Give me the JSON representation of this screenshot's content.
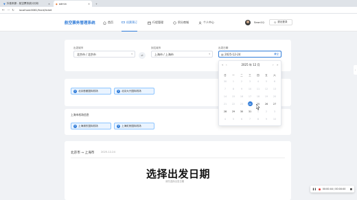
{
  "browser": {
    "tabs": [
      {
        "label": "抖音来源 - 航空票务统计分析"
      },
      {
        "label": "admin"
      }
    ],
    "new_tab": "+",
    "url": "localhost:8081/front/ticket"
  },
  "header": {
    "logo": "航空票务管理系统",
    "nav": [
      {
        "label": "首页"
      },
      {
        "label": "机票预订"
      },
      {
        "label": "行程管理"
      },
      {
        "label": "积分商城"
      },
      {
        "label": "个人中心"
      }
    ],
    "username": "Sean1Q",
    "logout_label": "退出登录"
  },
  "search": {
    "from_label": "出发城市",
    "from_value": "北京市 / 北京市",
    "to_label": "到达城市",
    "to_value": "上海市 / 上海市",
    "date_label": "出发日期",
    "date_value": "2025-12-24",
    "swap_label": "⇄",
    "clear_label": "清空"
  },
  "beijing_airports": {
    "title": "北京市机场信息",
    "items": [
      "北京首都国际机场",
      "北京大兴国际机场"
    ]
  },
  "shanghai_airports": {
    "title": "上海市机场信息",
    "items": [
      "上海浦东国际机场",
      "上海虹桥国际机场"
    ]
  },
  "picker": {
    "title": "2025 年  12 月",
    "weekdays": [
      "日",
      "一",
      "二",
      "三",
      "四",
      "五",
      "六"
    ],
    "rows": [
      [
        "30",
        "1",
        "2",
        "3",
        "4",
        "5",
        "6"
      ],
      [
        "7",
        "8",
        "9",
        "10",
        "11",
        "12",
        "13"
      ],
      [
        "14",
        "15",
        "16",
        "17",
        "18",
        "19",
        "20"
      ],
      [
        "21",
        "22",
        "23",
        "24",
        "25",
        "26",
        "27"
      ],
      [
        "28",
        "29",
        "30",
        "31",
        "1",
        "2",
        "3"
      ],
      [
        "4",
        "5",
        "6",
        "7",
        "8",
        "9",
        "10"
      ]
    ],
    "selected": "24"
  },
  "result": {
    "from": "北京市",
    "arrow": "→",
    "to": "上海市",
    "date": "2025-12-24",
    "placeholder_title": "选择出发日期",
    "placeholder_sub": "请先选择出发日期"
  },
  "recorder": {
    "time": "00:00:44 / 00:00:00"
  },
  "colors": {
    "accent": "#2f7bd8",
    "chip_bg": "#eaf4ff",
    "page_bg": "#f0f2f5"
  }
}
